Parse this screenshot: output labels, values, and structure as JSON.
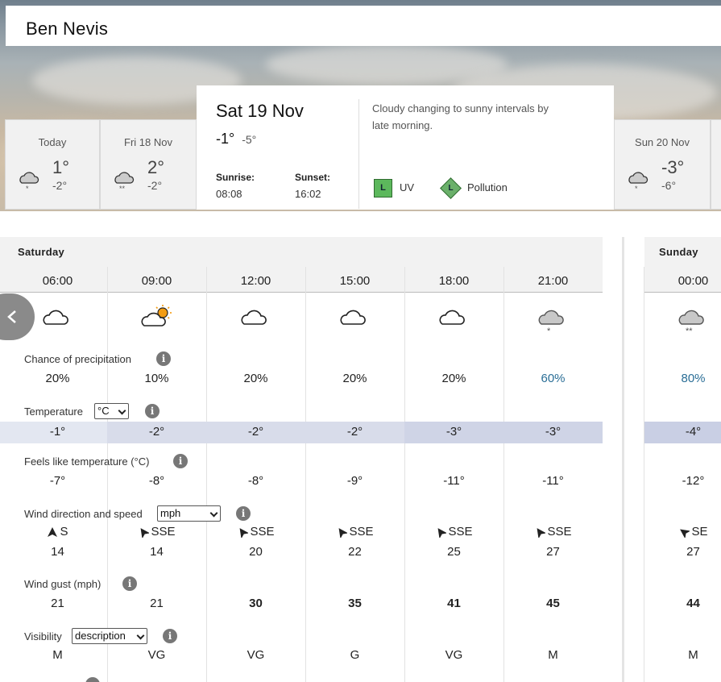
{
  "location": {
    "name": "Ben Nevis"
  },
  "day_cards": [
    {
      "label": "Today",
      "high": "1°",
      "low": "-2°",
      "icon": "cloud-snow-icon"
    },
    {
      "label": "Fri 18 Nov",
      "high": "2°",
      "low": "-2°",
      "icon": "cloud-snow-icon"
    },
    {
      "label": "Sun 20 Nov",
      "high": "-3°",
      "low": "-6°",
      "icon": "cloud-snow-icon"
    }
  ],
  "selected_day": {
    "date": "Sat 19 Nov",
    "high": "-1°",
    "low": "-5°",
    "sunrise_label": "Sunrise:",
    "sunrise": "08:08",
    "sunset_label": "Sunset:",
    "sunset": "16:02",
    "summary": "Cloudy changing to sunny intervals by late morning.",
    "uv_badge": "L",
    "uv_label": "UV",
    "pollution_badge": "L",
    "pollution_label": "Pollution"
  },
  "hourly": {
    "day1": "Saturday",
    "day2": "Sunday",
    "times": [
      "06:00",
      "09:00",
      "12:00",
      "15:00",
      "18:00",
      "21:00",
      "00:00"
    ],
    "icons": [
      "cloud-icon",
      "sun-cloud-icon",
      "cloud-icon",
      "cloud-icon",
      "cloud-icon",
      "cloud-snow-icon",
      "cloud-snow-icon"
    ],
    "precip_label": "Chance of precipitation",
    "precip": [
      "20%",
      "10%",
      "20%",
      "20%",
      "20%",
      "60%",
      "80%"
    ],
    "temp_label": "Temperature",
    "temp_unit": "°C",
    "temp": [
      "-1°",
      "-2°",
      "-2°",
      "-2°",
      "-3°",
      "-3°",
      "-4°"
    ],
    "feels_label": "Feels like temperature (°C)",
    "feels": [
      "-7°",
      "-8°",
      "-8°",
      "-9°",
      "-11°",
      "-11°",
      "-12°"
    ],
    "wind_label": "Wind direction and speed",
    "wind_unit": "mph",
    "wind_dir": [
      "S",
      "SSE",
      "SSE",
      "SSE",
      "SSE",
      "SSE",
      "SE"
    ],
    "wind_speed": [
      "14",
      "14",
      "20",
      "22",
      "25",
      "27",
      "27"
    ],
    "gust_label": "Wind gust (mph)",
    "gust": [
      "21",
      "21",
      "30",
      "35",
      "41",
      "45",
      "44"
    ],
    "vis_label": "Visibility",
    "vis_mode": "description",
    "vis": [
      "M",
      "VG",
      "VG",
      "G",
      "VG",
      "M",
      "M"
    ]
  },
  "colors": {
    "temp_band_light": "#e3e7f1",
    "temp_band_mid": "#d8dcea",
    "temp_band_dark": "#cfd4e6",
    "highlight_text": "#2a6e96",
    "badge_green": "#5cb85c"
  }
}
